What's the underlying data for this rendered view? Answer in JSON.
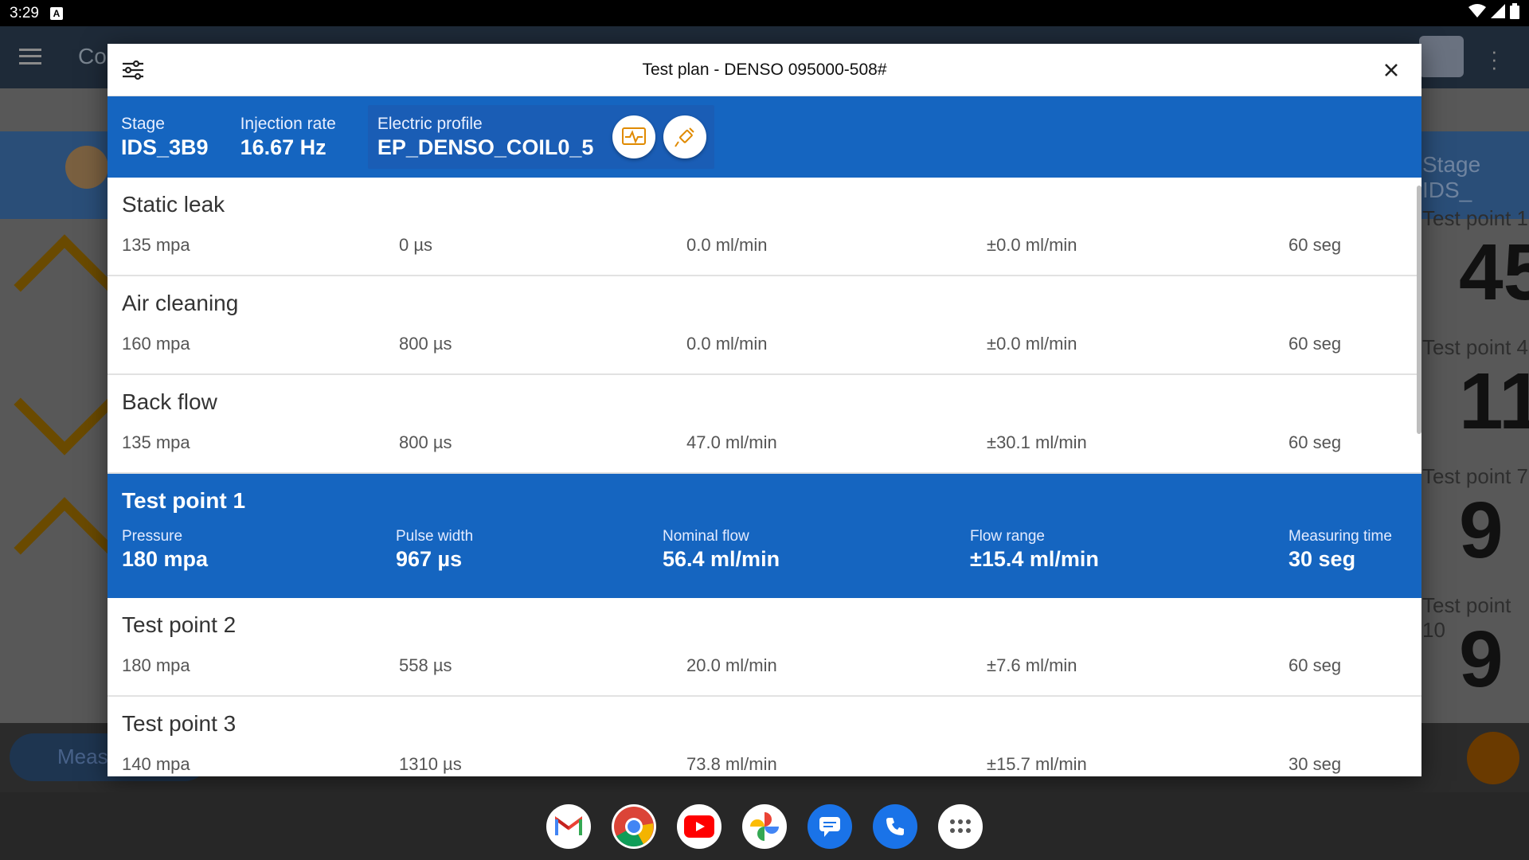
{
  "status_bar": {
    "time": "3:29",
    "notification": "A"
  },
  "background_app": {
    "title_partial": "Co",
    "stage_partial": "Stage IDS_",
    "test_points": [
      "Test point 1",
      "Test point 4",
      "Test point 7",
      "Test point 10"
    ],
    "big_values": [
      "45",
      "11",
      "9",
      "9"
    ],
    "measure_button_partial": "Meas"
  },
  "dialog": {
    "title": "Test plan - DENSO 095000-508#",
    "stage_label": "Stage",
    "stage_value": "IDS_3B9",
    "injection_rate_label": "Injection rate",
    "injection_rate_value": "16.67 Hz",
    "electric_profile_label": "Electric profile",
    "electric_profile_value": "EP_DENSO_COIL0_5",
    "rows": [
      {
        "title": "Static leak",
        "pressure": "135 mpa",
        "pulse": "0 µs",
        "flow": "0.0 ml/min",
        "range": "±0.0 ml/min",
        "time": "60 seg"
      },
      {
        "title": "Air cleaning",
        "pressure": "160 mpa",
        "pulse": "800 µs",
        "flow": "0.0 ml/min",
        "range": "±0.0 ml/min",
        "time": "60 seg"
      },
      {
        "title": "Back flow",
        "pressure": "135 mpa",
        "pulse": "800 µs",
        "flow": "47.0 ml/min",
        "range": "±30.1 ml/min",
        "time": "60 seg"
      }
    ],
    "selected": {
      "title": "Test point 1",
      "pressure_label": "Pressure",
      "pressure": "180 mpa",
      "pulse_label": "Pulse width",
      "pulse": "967 µs",
      "flow_label": "Nominal flow",
      "flow": "56.4 ml/min",
      "range_label": "Flow range",
      "range": "±15.4 ml/min",
      "time_label": "Measuring time",
      "time": "30 seg"
    },
    "rows_after": [
      {
        "title": "Test point 2",
        "pressure": "180 mpa",
        "pulse": "558 µs",
        "flow": "20.0 ml/min",
        "range": "±7.6 ml/min",
        "time": "60 seg"
      },
      {
        "title": "Test point 3",
        "pressure": "140 mpa",
        "pulse": "1310 µs",
        "flow": "73.8 ml/min",
        "range": "±15.7 ml/min",
        "time": "30 seg"
      }
    ]
  },
  "dock": [
    "gmail-icon",
    "chrome-icon",
    "youtube-icon",
    "photos-icon",
    "messages-icon",
    "phone-icon",
    "app-drawer-icon"
  ],
  "colors": {
    "accent": "#1565c0",
    "warning": "#e08a00"
  }
}
